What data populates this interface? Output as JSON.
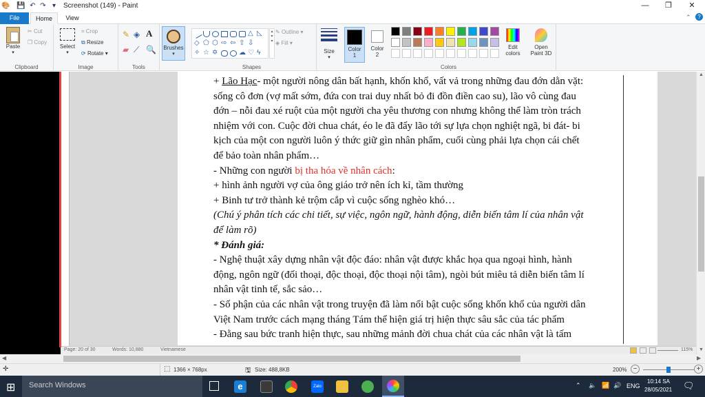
{
  "app": {
    "title": "Screenshot (149) - Paint",
    "window_controls": {
      "minimize": "—",
      "maximize": "❐",
      "close": "✕"
    }
  },
  "tabs": [
    {
      "label": "File"
    },
    {
      "label": "Home"
    },
    {
      "label": "View"
    }
  ],
  "ribbon": {
    "clipboard": {
      "paste": "Paste",
      "cut": "Cut",
      "copy": "Copy",
      "group": "Clipboard"
    },
    "image": {
      "select": "Select",
      "crop": "Crop",
      "resize": "Resize",
      "rotate": "Rotate",
      "group": "Image"
    },
    "tools": {
      "group": "Tools"
    },
    "brushes": {
      "label": "Brushes"
    },
    "shapes": {
      "outline": "Outline",
      "fill": "Fill",
      "group": "Shapes"
    },
    "size": {
      "label": "Size"
    },
    "color1": {
      "label": "Color",
      "number": "1",
      "value": "#000000"
    },
    "color2": {
      "label": "Color",
      "number": "2",
      "value": "#ffffff"
    },
    "colors": {
      "group": "Colors",
      "edit_1": "Edit",
      "edit_2": "colors",
      "p3d_1": "Open",
      "p3d_2": "Paint 3D"
    },
    "palette": [
      "#000000",
      "#7f7f7f",
      "#880015",
      "#ed1c24",
      "#ff7f27",
      "#fff200",
      "#22b14c",
      "#00a2e8",
      "#3f48cc",
      "#a349a4",
      "#ffffff",
      "#c3c3c3",
      "#b97a57",
      "#ffaec9",
      "#ffc90e",
      "#efe4b0",
      "#b5e61d",
      "#99d9ea",
      "#7092be",
      "#c8bfe7"
    ]
  },
  "document": {
    "lines": [
      {
        "segments": [
          {
            "text": "+ ",
            "style": ""
          },
          {
            "text": "Lão Hạc",
            "style": "ul"
          },
          {
            "text": "- một người nông dân bất hạnh, khốn khổ, vất vả trong những đau đớn dằn vặt:",
            "style": ""
          }
        ]
      },
      {
        "segments": [
          {
            "text": "sống cô đơn (vợ mất sớm, đứa con trai duy nhất bỏ đi đồn điền cao su), lão vô cùng đau",
            "style": ""
          }
        ]
      },
      {
        "segments": [
          {
            "text": "đớn – nỗi đau xé ruột của một người cha yêu thương con nhưng không thể làm tròn trách",
            "style": ""
          }
        ]
      },
      {
        "segments": [
          {
            "text": "nhiệm với con. Cuộc đời chua chát, éo le đã đẩy lão tới sự lựa chọn nghiệt ngã, bi đát- bi",
            "style": ""
          }
        ]
      },
      {
        "segments": [
          {
            "text": "kịch của một con người luôn ý thức giữ gìn nhân phẩm, cuối cùng phải lựa chọn cái chết",
            "style": ""
          }
        ]
      },
      {
        "segments": [
          {
            "text": "để bảo toàn nhân phẩm…",
            "style": ""
          }
        ]
      },
      {
        "segments": [
          {
            "text": "- Những con người ",
            "style": ""
          },
          {
            "text": "bị tha hóa về nhân cách",
            "style": "red"
          },
          {
            "text": ":",
            "style": ""
          }
        ]
      },
      {
        "segments": [
          {
            "text": "+ hình ảnh người vợ của ông giáo trở nên ích kỉ, tầm thường",
            "style": ""
          }
        ]
      },
      {
        "segments": [
          {
            "text": "+  Binh tư trở thành kẻ trộm cắp vì cuộc sống nghèo khó…",
            "style": ""
          }
        ]
      },
      {
        "segments": [
          {
            "text": "(Chú ý phân tích các chi tiết, sự việc, ngôn ngữ, hành động, diễn biến tâm lí của nhân vật",
            "style": "it"
          }
        ]
      },
      {
        "segments": [
          {
            "text": "để làm rõ)",
            "style": "it"
          }
        ]
      },
      {
        "segments": [
          {
            "text": "* Đánh giá:",
            "style": "bi"
          }
        ]
      },
      {
        "segments": [
          {
            "text": "- Nghệ thuật xây dựng nhân vật độc đáo: nhân vật được khắc họa qua ngoại hình, hành",
            "style": ""
          }
        ]
      },
      {
        "segments": [
          {
            "text": "động, ngôn ngữ (đối thoại, độc thoại, độc thoại nội tâm), ngòi bút miêu tả diễn biến tâm lí",
            "style": ""
          }
        ]
      },
      {
        "segments": [
          {
            "text": "nhân vật tinh tế, sắc sảo…",
            "style": ""
          }
        ]
      },
      {
        "segments": [
          {
            "text": "- Số phận của các nhân vật trong truyện đã làm nổi bật cuộc sống khốn khổ của người dân",
            "style": ""
          }
        ]
      },
      {
        "segments": [
          {
            "text": "Việt Nam trước cách mạng tháng Tám thể hiện giá trị hiện thực sâu sắc của tác phẩm",
            "style": ""
          }
        ]
      },
      {
        "segments": [
          {
            "text": "- Đằng sau bức tranh hiện thực, sau những mảnh đời chua chát của các nhân vật là tấm",
            "style": ""
          }
        ]
      }
    ],
    "word_status": {
      "page": "Page: 20 of 30",
      "words": "Words: 10,880",
      "lang": "Vietnamese",
      "zoom": "115%"
    }
  },
  "statusbar": {
    "dimensions": "1366 × 768px",
    "size": "Size: 488,8KB",
    "zoom": "200%",
    "zoom_fraction": 0.5
  },
  "taskbar": {
    "search": "Search Windows",
    "lang": "ENG",
    "time": "10:14 SA",
    "date": "28/05/2021"
  }
}
